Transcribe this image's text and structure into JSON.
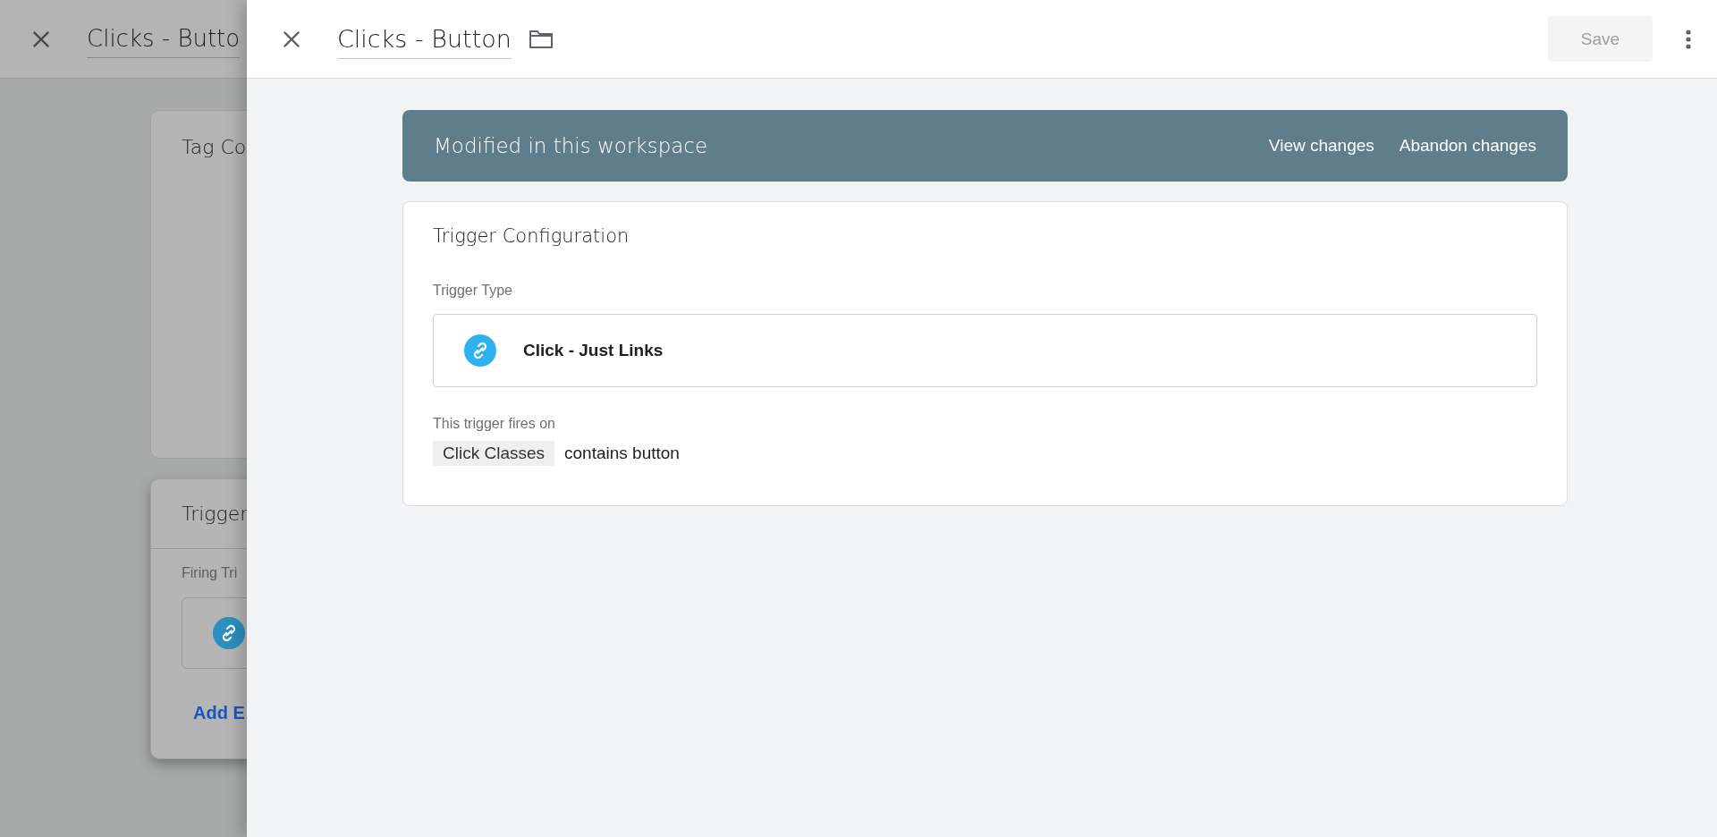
{
  "background_panel": {
    "title": "Clicks - Butto",
    "tag_card": {
      "title": "Tag Co"
    },
    "trigger_card": {
      "title": "Trigger",
      "label": "Firing Tri",
      "add_link": "Add E"
    }
  },
  "header": {
    "title": "Clicks - Button",
    "save": {
      "label": "Save",
      "disabled": true
    }
  },
  "banner": {
    "text": "Modified in this workspace",
    "actions": [
      "View changes",
      "Abandon changes"
    ]
  },
  "trigger_card": {
    "title": "Trigger Configuration",
    "type_label": "Trigger Type",
    "type_name": "Click - Just Links",
    "fires_label": "This trigger fires on",
    "conditions": [
      {
        "variable": "Click Classes",
        "rule": "contains button"
      }
    ]
  }
}
